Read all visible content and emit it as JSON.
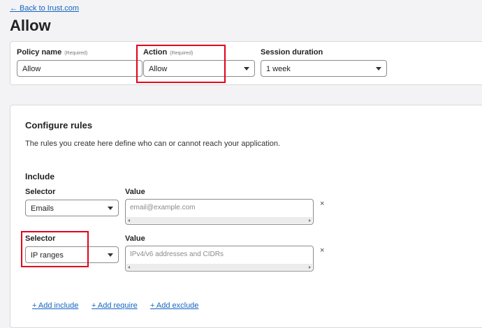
{
  "nav": {
    "back_link": "← Back to Irust.com"
  },
  "page": {
    "title": "Allow"
  },
  "policy": {
    "name_label": "Policy name",
    "name_required": "(Required)",
    "name_value": "Allow",
    "action_label": "Action",
    "action_required": "(Required)",
    "action_value": "Allow",
    "session_label": "Session duration",
    "session_value": "1 week"
  },
  "rules": {
    "title": "Configure rules",
    "description": "The rules you create here define who can or cannot reach your application.",
    "include_title": "Include",
    "rows": [
      {
        "selector_label": "Selector",
        "selector_value": "Emails",
        "value_label": "Value",
        "value_placeholder": "email@example.com",
        "remove": "×"
      },
      {
        "selector_label": "Selector",
        "selector_value": "IP ranges",
        "value_label": "Value",
        "value_placeholder": "IPv4/v6 addresses and CIDRs",
        "remove": "×"
      }
    ],
    "add_include": "+ Add include",
    "add_require": "+ Add require",
    "add_exclude": "+ Add exclude"
  },
  "colors": {
    "link": "#1565c0",
    "highlight": "#e3001b"
  },
  "icons": {
    "dropdown": "chevron-down-icon",
    "remove": "close-icon"
  }
}
